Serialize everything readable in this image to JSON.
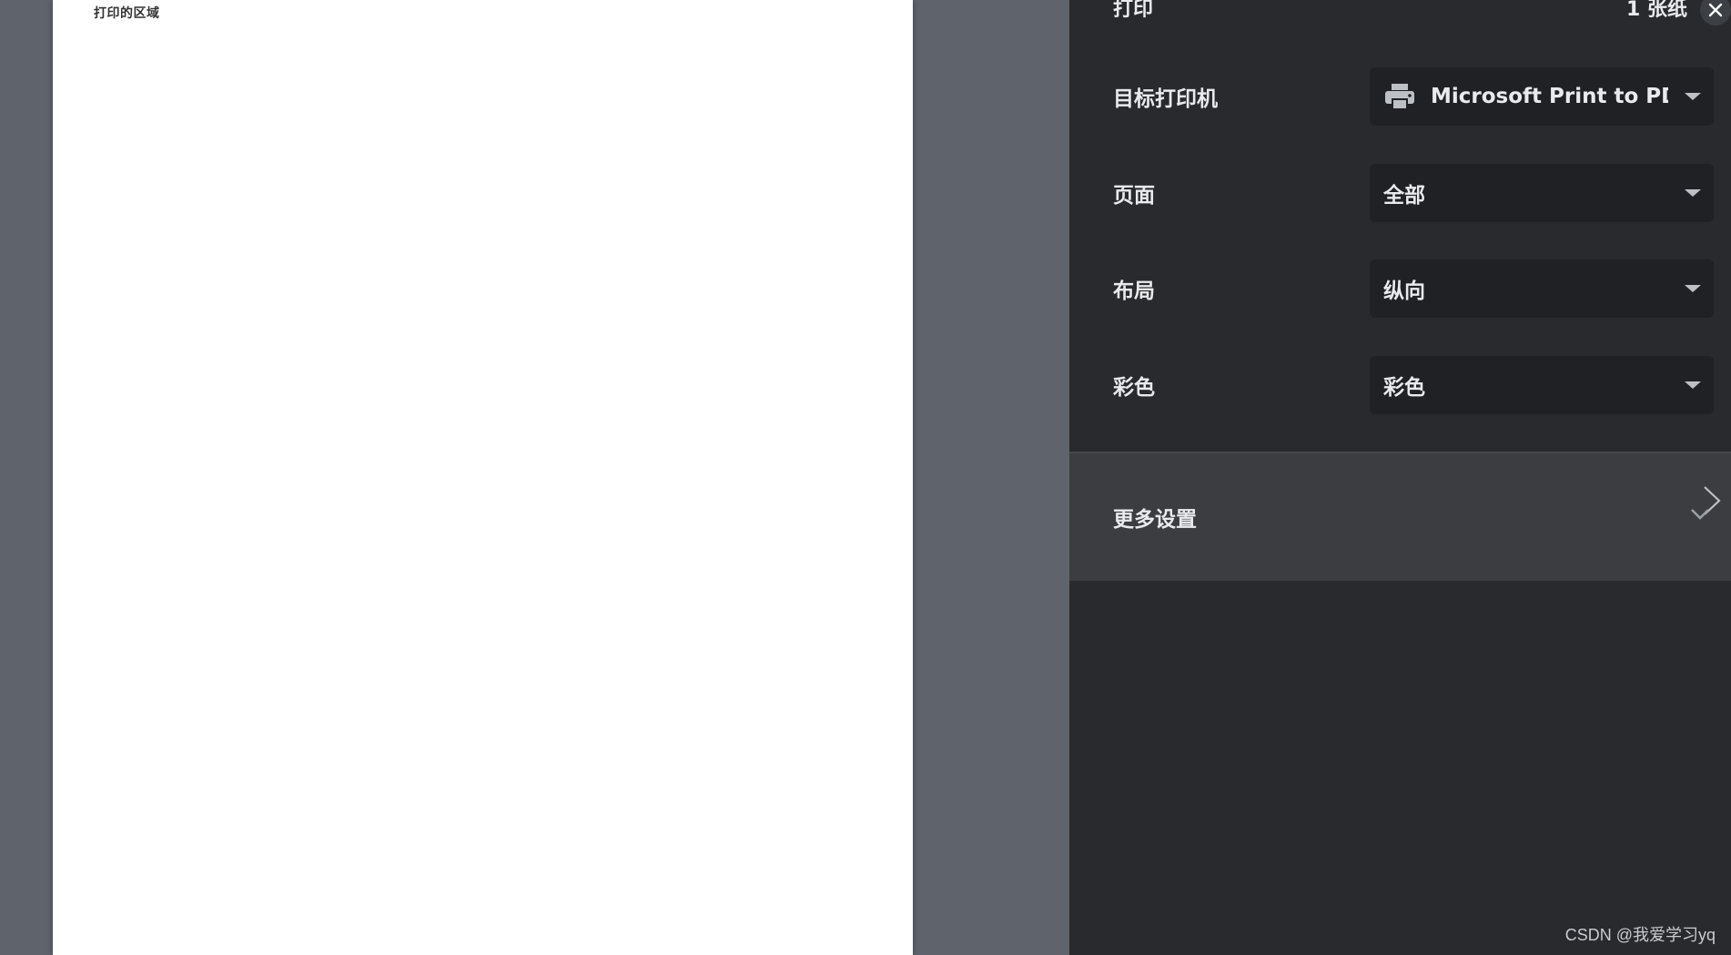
{
  "preview": {
    "sheet_text": "打印的区域"
  },
  "sidebar": {
    "title": "打印",
    "sheet_count": "1 张纸",
    "close_icon": "close-icon",
    "settings": {
      "printer": {
        "label": "目标打印机",
        "value": "Microsoft Print to PDF",
        "icon": "printer-icon"
      },
      "pages": {
        "label": "页面",
        "value": "全部"
      },
      "layout": {
        "label": "布局",
        "value": "纵向"
      },
      "color": {
        "label": "彩色",
        "value": "彩色"
      }
    },
    "more_settings": {
      "label": "更多设置",
      "icons": [
        "chevron-down-icon",
        "chevron-right-icon"
      ]
    }
  },
  "watermark": "CSDN @我爱学习yq",
  "colors": {
    "sidebar_bg": "#292a2d",
    "select_bg": "#202124",
    "preview_bg": "#5f636c",
    "text": "#e8eaed",
    "more_bg": "#3c3d40"
  }
}
